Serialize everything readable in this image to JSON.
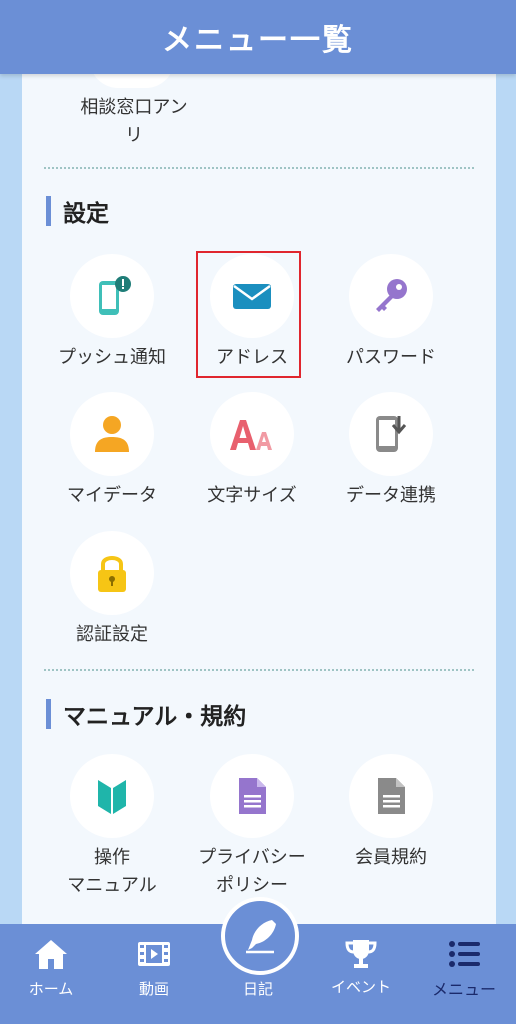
{
  "header": {
    "title": "メニュー一覧"
  },
  "top_item": {
    "label": "相談窓口アン\nリ"
  },
  "sections": {
    "settings": {
      "title": "設定",
      "items": [
        {
          "label": "プッシュ通知",
          "icon": "phone-notification-icon"
        },
        {
          "label": "アドレス",
          "icon": "mail-icon"
        },
        {
          "label": "パスワード",
          "icon": "key-icon"
        },
        {
          "label": "マイデータ",
          "icon": "person-icon"
        },
        {
          "label": "文字サイズ",
          "icon": "font-size-icon"
        },
        {
          "label": "データ連携",
          "icon": "phone-download-icon"
        },
        {
          "label": "認証設定",
          "icon": "lock-icon"
        }
      ]
    },
    "manual": {
      "title": "マニュアル・規約",
      "items": [
        {
          "label": "操作\nマニュアル",
          "icon": "beginner-mark-icon"
        },
        {
          "label": "プライバシー\nポリシー",
          "icon": "document-icon"
        },
        {
          "label": "会員規約",
          "icon": "document-icon"
        }
      ]
    }
  },
  "bottom_nav": {
    "home": "ホーム",
    "video": "動画",
    "diary": "日記",
    "event": "イベント",
    "menu": "メニュー"
  },
  "colors": {
    "header": "#6b8fd6",
    "highlight": "#e0262e",
    "mail": "#1b8fbf",
    "key": "#9575cd",
    "person": "#f5a623",
    "font_a": "#e8606e",
    "lock": "#f6c515",
    "beginner": "#1fb5aa"
  }
}
